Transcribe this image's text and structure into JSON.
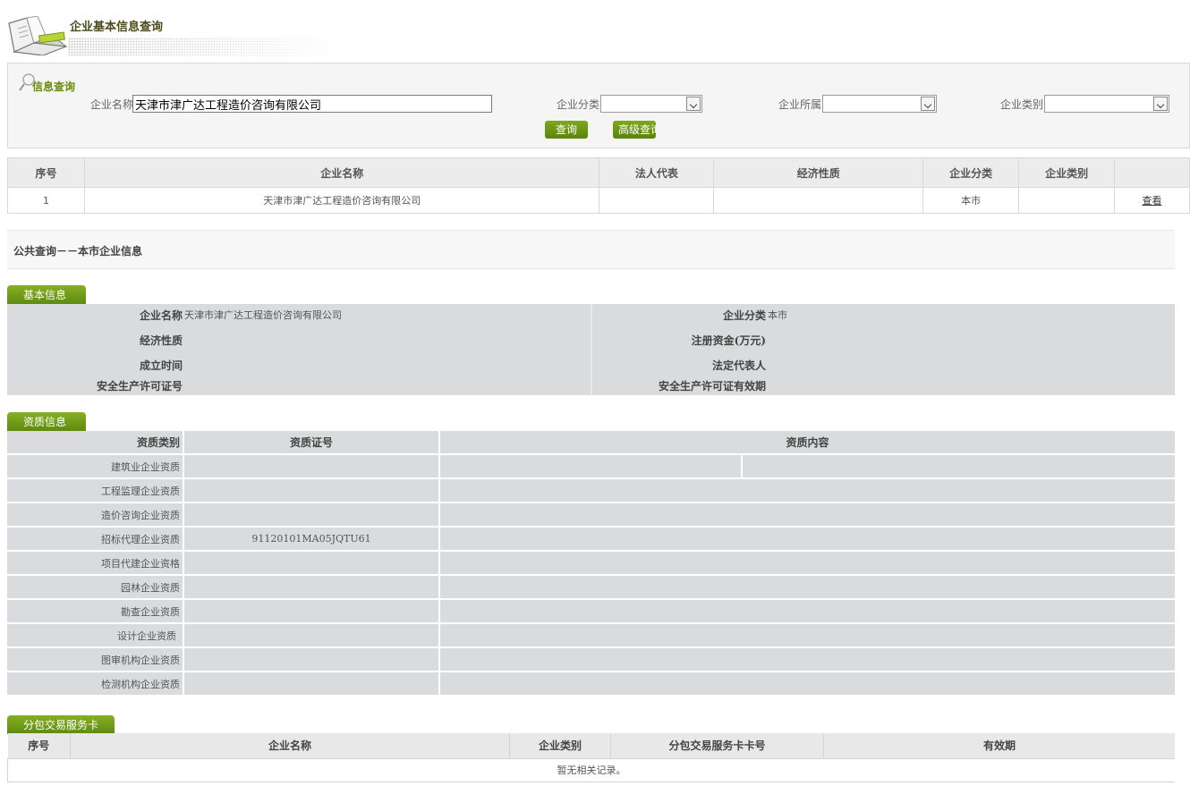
{
  "header": {
    "title": "企业基本信息查询"
  },
  "search": {
    "section_title": "信息查询",
    "name_label": "企业名称",
    "name_value": "天津市津广达工程造价咨询有限公司",
    "classification_label": "企业分类",
    "belonging_label": "企业所属",
    "category_label": "企业类别",
    "query_button": "查询",
    "advanced_button": "高级查询"
  },
  "results": {
    "columns": [
      "序号",
      "企业名称",
      "法人代表",
      "经济性质",
      "企业分类",
      "企业类别",
      ""
    ],
    "rows": [
      {
        "index": "1",
        "name": "天津市津广达工程造价咨询有限公司",
        "legal_rep": "",
        "economic_nature": "",
        "classification": "本市",
        "category": "",
        "action": "查看"
      }
    ]
  },
  "public_query_title": "公共查询－－本市企业信息",
  "basic": {
    "tab": "基本信息",
    "name_label": "企业名称",
    "name_value": "天津市津广达工程造价咨询有限公司",
    "classification_label": "企业分类",
    "classification_value": "本市",
    "economic_label": "经济性质",
    "capital_label": "注册资金(万元)",
    "established_label": "成立时间",
    "legal_rep_label": "法定代表人",
    "license_label": "安全生产许可证号",
    "license_validity_label": "安全生产许可证有效期"
  },
  "qualification": {
    "tab": "资质信息",
    "columns": [
      "资质类别",
      "资质证号",
      "资质内容"
    ],
    "rows": [
      {
        "type": "建筑业企业资质",
        "cert": ""
      },
      {
        "type": "工程监理企业资质",
        "cert": ""
      },
      {
        "type": "造价咨询企业资质",
        "cert": ""
      },
      {
        "type": "招标代理企业资质",
        "cert": "91120101MA05JQTU61"
      },
      {
        "type": "项目代建企业资格",
        "cert": ""
      },
      {
        "type": "园林企业资质",
        "cert": ""
      },
      {
        "type": "勘查企业资质",
        "cert": ""
      },
      {
        "type": "设计企业资质",
        "cert": ""
      },
      {
        "type": "图审机构企业资质",
        "cert": ""
      },
      {
        "type": "检测机构企业资质",
        "cert": ""
      }
    ]
  },
  "subcontract": {
    "tab": "分包交易服务卡",
    "columns": [
      "序号",
      "企业名称",
      "企业类别",
      "分包交易服务卡卡号",
      "有效期"
    ],
    "empty_text": "暂无相关记录。"
  },
  "colors": {
    "accent": "#6b8a10",
    "button": "#6a9616",
    "panel": "#d9dbdc"
  }
}
